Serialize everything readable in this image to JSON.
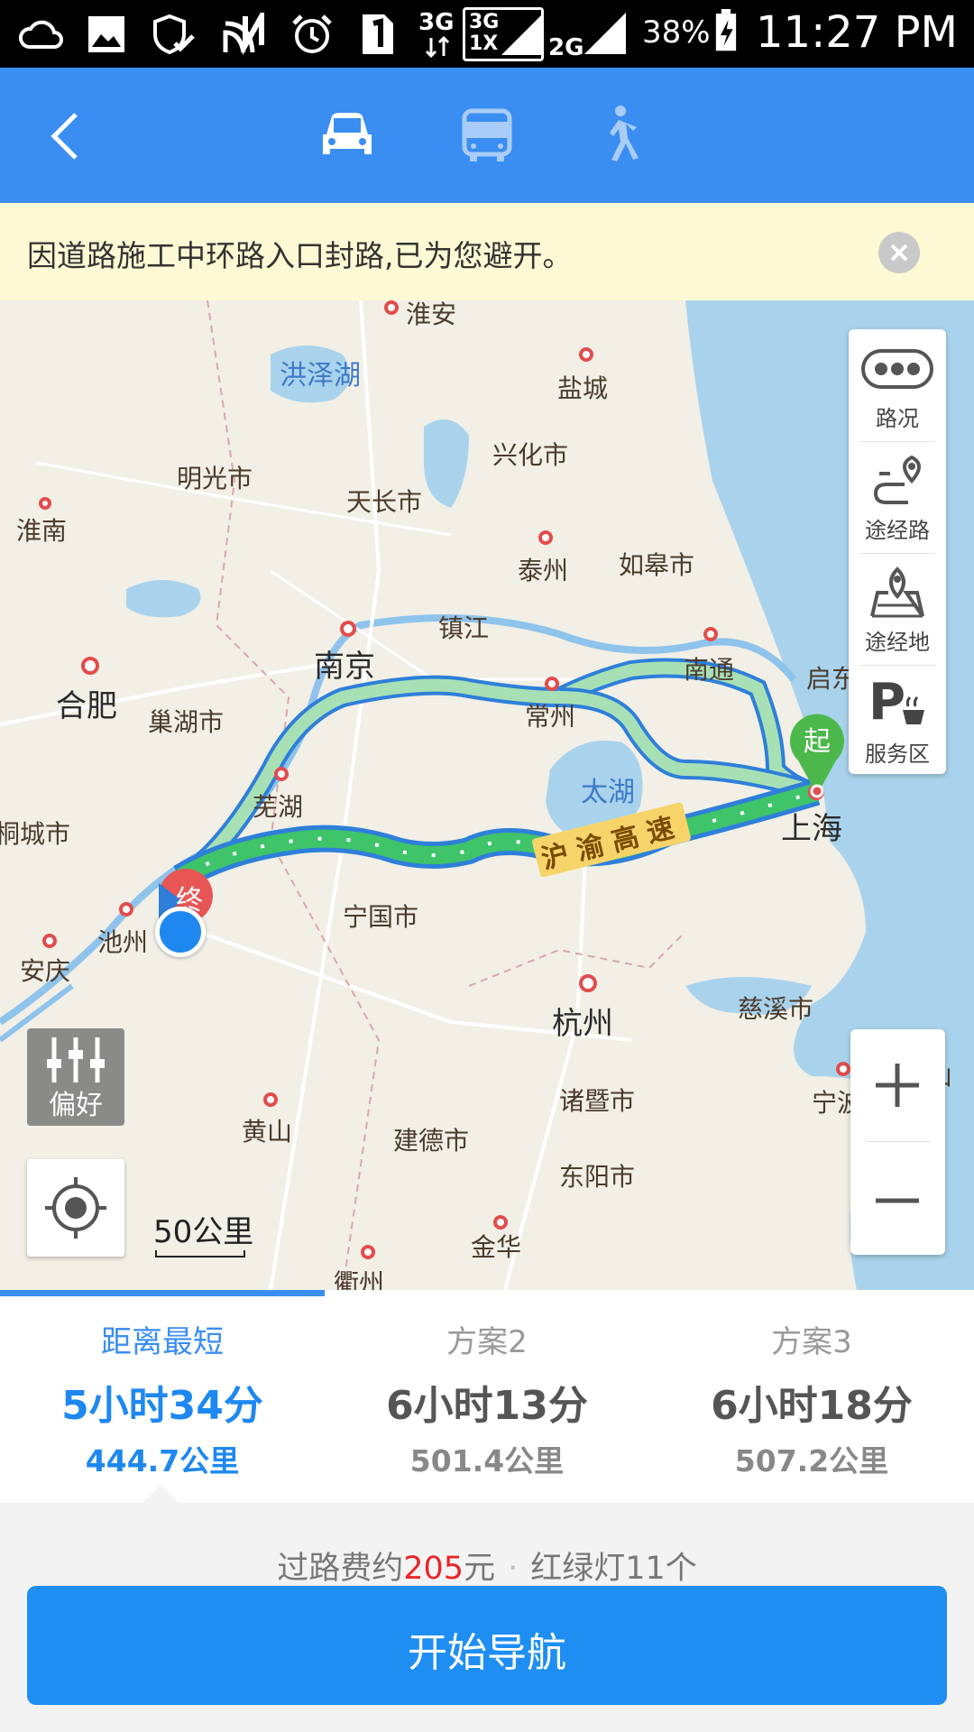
{
  "status_bar": {
    "network_3g": "3G",
    "network_3g_1x": "3G 1X",
    "network_2g": "2G",
    "battery": "38%",
    "time": "11:27 PM"
  },
  "header": {
    "modes": [
      "car",
      "bus",
      "walk"
    ],
    "active_mode": "car"
  },
  "notice": {
    "message": "因道路施工中环路入口封路,已为您避开。"
  },
  "map": {
    "cities": {
      "huaian": "淮安",
      "yancheng": "盐城",
      "xinghua": "兴化市",
      "mingguang": "明光市",
      "tianchang": "天长市",
      "huainan": "淮南",
      "taizhou": "泰州",
      "rugao": "如皋市",
      "zhenjiang": "镇江",
      "nanjing": "南京",
      "nantong": "南通",
      "qidong": "启东",
      "hefei": "合肥",
      "chaohu": "巢湖市",
      "changzhou": "常州",
      "wuhu": "芜湖",
      "tongcheng": "桐城市",
      "shanghai": "上海",
      "ningguo": "宁国市",
      "chizhou": "池州",
      "anqing": "安庆",
      "hangzhou": "杭州",
      "cixi": "慈溪市",
      "zhoushan": "舟山",
      "ningbo": "宁波",
      "huangshan": "黄山",
      "zhuji": "诸暨市",
      "jiande": "建德市",
      "dongyang": "东阳市",
      "jinhua": "金华",
      "quzhou": "衢州"
    },
    "lakes": {
      "hongze": "洪泽湖",
      "taihu": "太湖"
    },
    "road_label": "沪渝高速",
    "start_marker": "起",
    "end_marker": "终",
    "scale": "50公里"
  },
  "right_panel": {
    "traffic": "路况",
    "via_road": "途经路",
    "via_place": "途经地",
    "service": "服务区"
  },
  "preference": "偏好",
  "routes": [
    {
      "name": "距离最短",
      "time": "5小时34分",
      "distance": "444.7公里"
    },
    {
      "name": "方案2",
      "time": "6小时13分",
      "distance": "501.4公里"
    },
    {
      "name": "方案3",
      "time": "6小时18分",
      "distance": "507.2公里"
    }
  ],
  "trip_info": {
    "toll_prefix": "过路费约",
    "toll_amount": "205",
    "toll_suffix": "元",
    "lights": "红绿灯11个"
  },
  "start_navigation": "开始导航",
  "colors": {
    "accent": "#3a8ef2",
    "route_main": "#3fc46a",
    "route_alt": "#a8e0b6",
    "toll_red": "#e8252a"
  }
}
